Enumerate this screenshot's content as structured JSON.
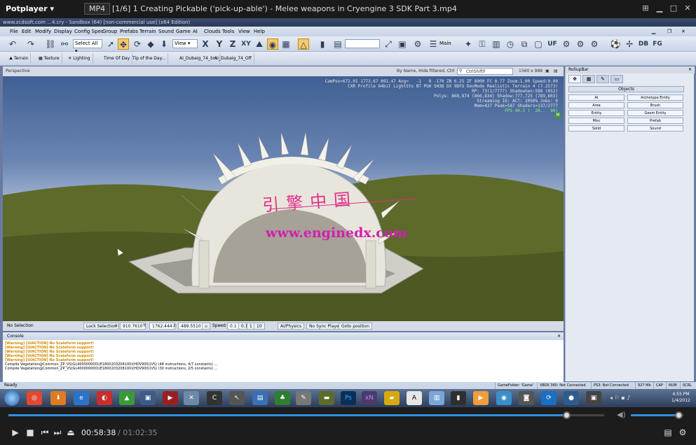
{
  "player": {
    "app_name": "Potplayer",
    "format": "MP4",
    "file_title": "[1/6] 1 Creating Pickable ('pick-up-able') - Melee weapons in Cryengine 3 SDK Part 3.mp4",
    "time_current": "00:58:38",
    "time_total": "/ 01:02:35",
    "progress": 0.937,
    "volume": 0.9
  },
  "editor": {
    "window_title": "www.zcdsoft.com  ...4.cry - Sandbox (64) [non-commercial use] (x64 Edition)",
    "menu": [
      "File",
      "Edit",
      "Modify",
      "Display",
      "Config Spec",
      "Group",
      "Prefabs",
      "Terrain",
      "Sound",
      "Game",
      "AI",
      "Clouds",
      "Tools",
      "View",
      "Help"
    ],
    "select_all": "Select All",
    "view_dropdown": "View",
    "main_button": "Main",
    "tb_letters": [
      "X",
      "Y",
      "Z",
      "XY"
    ],
    "tb_right": [
      "UF",
      "DB",
      "FG"
    ],
    "toolbar2": [
      "Terrain",
      "Texture",
      "Lighting",
      "Time Of Day",
      "Tip of the Day...",
      "AI_Dubaig_74_Sm",
      "AI_Dubaig_74_Off"
    ],
    "viewport_label": "Perspective",
    "viewport_filter": "By Name, Hide filtered, Ctrl",
    "viewport_search": "CtrlShiftF",
    "viewport_res": "1560 x 988",
    "hud_lines": [
      "CamPos=672.01 1773.67 091.47 Ang=   -1   0 -170 ZN 0.25 ZF 8000 FC 0.77 Zoom:1.00 Speed:0.00",
      "CXR Profile 64bit LightSto NT PGH SH3B DX 9DFU DevMode Realistic Terrain 4 (7.2573)",
      "RP: 73(1/7777) ShadowGen:588 (852)",
      "Polys: 868,874 (866,834) Shadow:777,725 (789,803)",
      "Streaming IO: ACT: 2050% Jobs: 0",
      "Mem=427 Peak=587 Shaders=137/2777",
      "FPS 40.2 (  20..  90)"
    ],
    "watermark_cn": "引擎中国",
    "watermark_url": "www.enginedx.com",
    "status": {
      "selection": "No Selection",
      "lock": "Lock Selection",
      "x_label": "x:",
      "x": "910.7610",
      "y_label": "Y:",
      "y": "1762.444",
      "z_label": "z:",
      "z": "489.5510",
      "speed_label": "Speed:",
      "speed": "0.1",
      "speed_opts": [
        "0.1",
        "1",
        "10"
      ],
      "physics": "AI/Physics",
      "sync": "No Sync Player",
      "goto": "Goto position"
    },
    "console_title": "Console",
    "console_lines": [
      "[Warning] [UIACTION] No Scaleform support!",
      "[Warning] [UIACTION] No Scaleform support!",
      "[Warning] [UIACTION] No Scaleform support!",
      "[Warning] [UIACTION] No Scaleform support!",
      "[Warning] [UIACTION] No Scaleform support!",
      "Compile Vegetation@Common_ZP_VS(GL400000000)(E1800203208100)(HDV900)(VS) (48 instructions, 4/7 constants) ...",
      "Compile Vegetation@Common_ZP_VS(GL400000000)(E1800203208100)(HDV900)(VS) (30 instructions, 2/5 constants) ..."
    ],
    "ready": "Ready",
    "status_right": [
      "GameFolder: 'Game'",
      "XBOX 360: Not Connected",
      "PS3: Not Connected",
      "927 Mb",
      "CAP",
      "NUM",
      "SCRL"
    ],
    "rollup_title": "RollupBar",
    "objects_title": "Objects",
    "objects": [
      "AI",
      "Archetype Entity",
      "Area",
      "Brush",
      "Entity",
      "Geom Entity",
      "Misc",
      "Prefab",
      "Solid",
      "Sound"
    ]
  },
  "taskbar": {
    "apps": [
      "Ps",
      "xN"
    ],
    "time": "4:55 PM",
    "date": "1/4/2012"
  }
}
